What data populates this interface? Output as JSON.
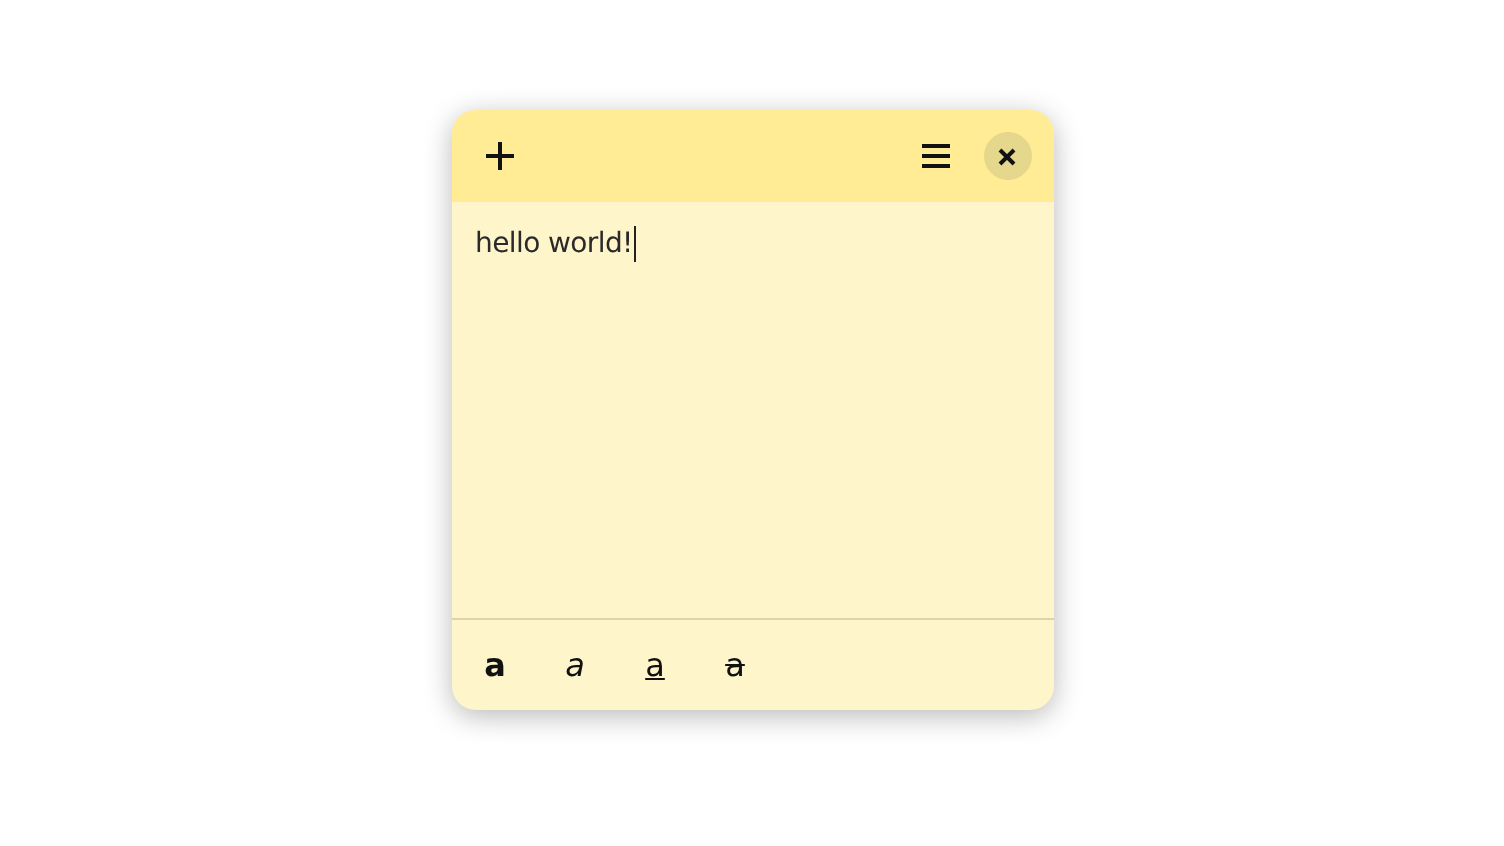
{
  "note": {
    "text": "hello world!",
    "format_buttons": [
      {
        "kind": "bold",
        "label": "a"
      },
      {
        "kind": "italic",
        "label": "a"
      },
      {
        "kind": "underline",
        "label": "a"
      },
      {
        "kind": "strikethrough",
        "label": "a"
      }
    ]
  }
}
